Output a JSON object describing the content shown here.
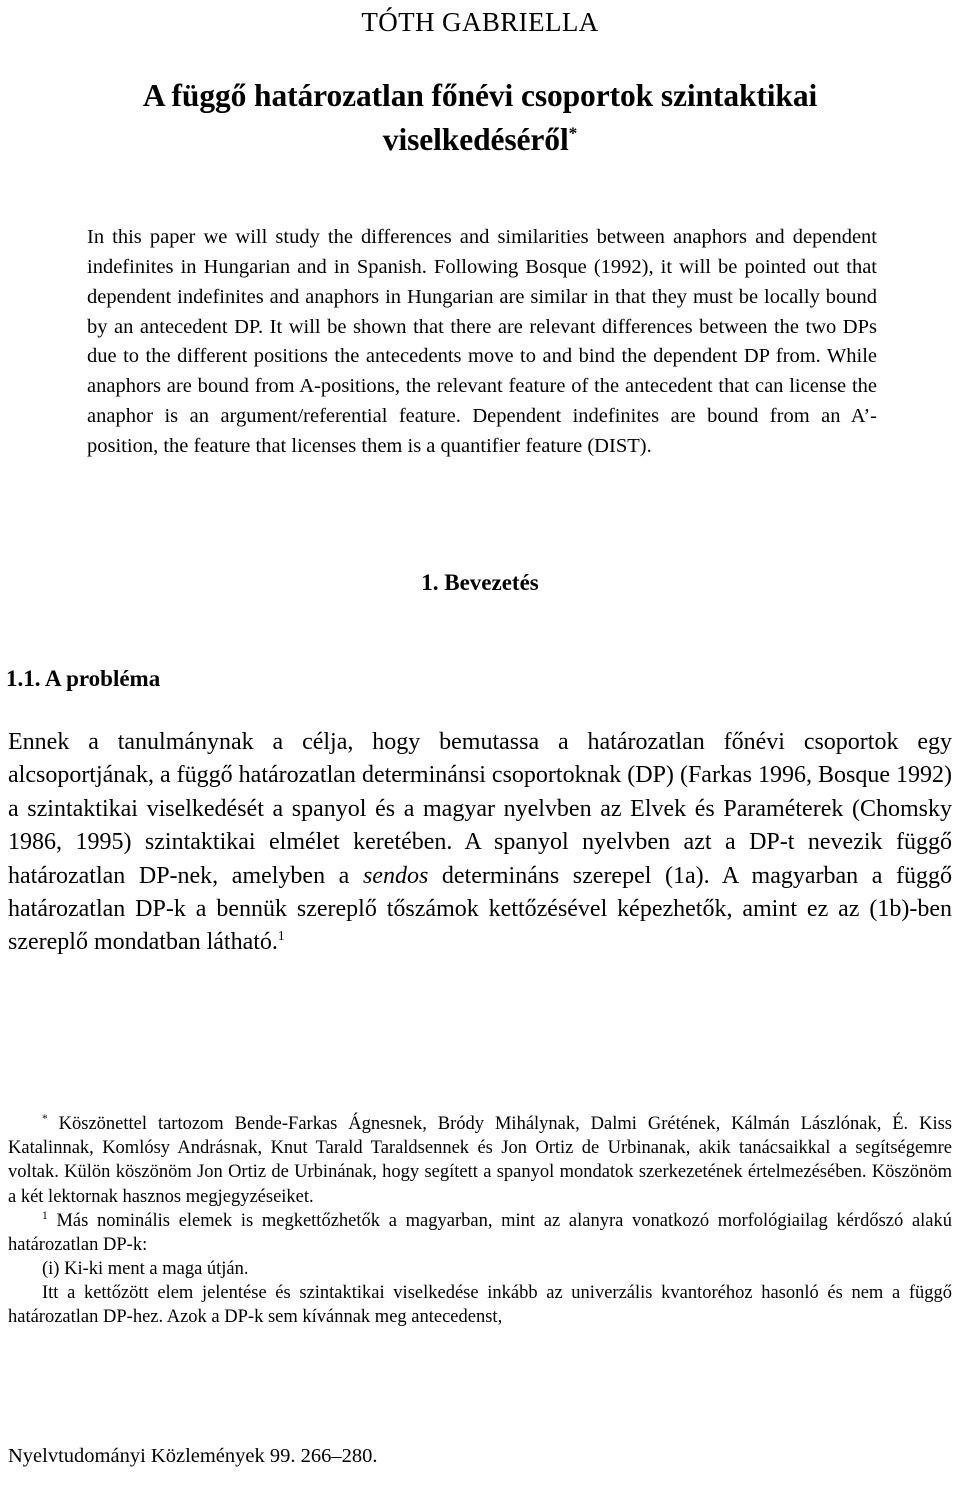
{
  "document": {
    "author": "TÓTH GABRIELLA",
    "title_line1": "A függő határozatlan főnévi csoportok szintaktikai",
    "title_line2": "viselkedéséről",
    "title_footnote_marker": "*",
    "abstract": "In this paper we will study the differences and similarities between anaphors and dependent indefinites in Hungarian and in Spanish. Following Bosque (1992), it will be pointed out that dependent indefinites and anaphors in Hungarian are similar in that they must be locally bound by an antecedent DP. It will be shown that there are relevant differences between the two DPs due to the different positions the antecedents move to and bind the dependent DP from. While anaphors are bound from A-positions, the relevant feature of the antecedent that can license the anaphor is an argument/referential feature. Dependent indefinites are bound from an A’-position, the feature that licenses them is a quantifier feature (DIST).",
    "section_heading_1": "1. Bevezetés",
    "section_heading_1_1": "1.1. A probléma",
    "body_paragraph_part1": "Ennek a tanulmánynak a célja, hogy bemutassa a határozatlan főnévi csoportok egy alcsoportjának, a függő határozatlan determinánsi csoportoknak (DP) (Farkas 1996, Bosque 1992) a szintaktikai viselkedését a spanyol és a magyar nyelvben az Elvek és Paraméterek (Chomsky 1986, 1995) szintaktikai elmélet keretében. A spanyol nyelvben azt a DP-t nevezik függő határozatlan DP-nek, amelyben a ",
    "body_paragraph_italic": "sendos",
    "body_paragraph_part2": " determináns szerepel (1a). A magyarban a függő határozatlan DP-k a bennük szereplő tőszámok kettőzésével képezhetők, amint ez az (1b)-ben szereplő mondatban látható.",
    "body_paragraph_footnote_marker": "1",
    "footnote_star_marker": "*",
    "footnote_star_text": "Köszönettel tartozom Bende-Farkas Ágnesnek, Bródy Mihálynak, Dalmi Grétének, Kálmán Lászlónak, É. Kiss Katalinnak, Komlósy Andrásnak, Knut Tarald Taraldsennek és Jon Ortiz de Urbinanak, akik tanácsaikkal a segítségemre voltak. Külön köszönöm Jon Ortiz de Urbinának, hogy segített a spanyol mondatok szerkezetének értelmezésében. Köszönöm a két lektornak hasznos megjegyzéseiket.",
    "footnote_one_marker": "1",
    "footnote_one_text": "Más nominális elemek is megkettőzhetők a magyarban, mint az alanyra vonatkozó morfológiailag kérdőszó alakú határozatlan DP-k:",
    "footnote_one_example": "(i) Ki-ki ment a maga útján.",
    "footnote_one_continuation": "Itt a kettőzött elem jelentése és szintaktikai viselkedése inkább az univerzális kvantoréhoz hasonló és nem a függő határozatlan DP-hez. Azok a DP-k sem kívánnak meg antecedenst,",
    "footer": "Nyelvtudományi Közlemények 99. 266–280."
  }
}
